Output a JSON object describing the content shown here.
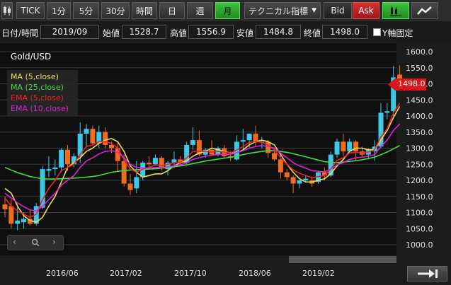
{
  "toolbar": {
    "buttons": [
      {
        "label": "TICK"
      },
      {
        "label": "1分"
      },
      {
        "label": "5分"
      },
      {
        "label": "30分"
      },
      {
        "label": "時間"
      },
      {
        "label": "日"
      },
      {
        "label": "週"
      },
      {
        "label": "月"
      }
    ],
    "active": "月",
    "indicator_dropdown": "テクニカル指標",
    "bid_label": "Bid",
    "ask_label": "Ask",
    "chart_type_icon": "candlestick-icon",
    "line_icon": "line-chart-icon"
  },
  "info": {
    "date_label": "日付/時間",
    "date_value": "2019/09",
    "open_label": "始値",
    "open_value": "1528.7",
    "high_label": "高値",
    "high_value": "1556.9",
    "low_label": "安値",
    "low_value": "1484.8",
    "close_label": "終値",
    "close_value": "1498.0",
    "yfix_label": "Y軸固定"
  },
  "chart": {
    "symbol": "Gold/USD",
    "last_price": "1498.0",
    "legend": [
      {
        "label": "MA (5,close)",
        "color": "#e8e050"
      },
      {
        "label": "MA (25,close)",
        "color": "#44dd44"
      },
      {
        "label": "EMA (5,close)",
        "color": "#ee2222"
      },
      {
        "label": "EMA (10,close)",
        "color": "#dd22dd"
      }
    ],
    "y_ticks": [
      "1600.0",
      "1550.0",
      "1500.0",
      "1450.0",
      "1400.0",
      "1350.0",
      "1300.0",
      "1250.0",
      "1200.0",
      "1150.0",
      "1100.0",
      "1050.0",
      "1000.0"
    ],
    "x_ticks": [
      "2016/06",
      "2017/02",
      "2017/10",
      "2018/06",
      "2019/02"
    ],
    "up_color": "#3ec8e8",
    "down_color": "#f26a1e"
  },
  "chart_data": {
    "type": "candlestick",
    "ylim": [
      1000,
      1600
    ],
    "candles": [
      {
        "o": 1125,
        "h": 1150,
        "l": 1085,
        "c": 1110
      },
      {
        "o": 1120,
        "h": 1140,
        "l": 1050,
        "c": 1065
      },
      {
        "o": 1065,
        "h": 1120,
        "l": 1045,
        "c": 1075
      },
      {
        "o": 1070,
        "h": 1100,
        "l": 1050,
        "c": 1080
      },
      {
        "o": 1080,
        "h": 1110,
        "l": 1060,
        "c": 1065
      },
      {
        "o": 1065,
        "h": 1130,
        "l": 1060,
        "c": 1120
      },
      {
        "o": 1115,
        "h": 1245,
        "l": 1110,
        "c": 1235
      },
      {
        "o": 1230,
        "h": 1275,
        "l": 1210,
        "c": 1235
      },
      {
        "o": 1235,
        "h": 1265,
        "l": 1215,
        "c": 1240
      },
      {
        "o": 1240,
        "h": 1300,
        "l": 1225,
        "c": 1295
      },
      {
        "o": 1295,
        "h": 1310,
        "l": 1230,
        "c": 1250
      },
      {
        "o": 1250,
        "h": 1285,
        "l": 1240,
        "c": 1275
      },
      {
        "o": 1275,
        "h": 1380,
        "l": 1255,
        "c": 1345
      },
      {
        "o": 1345,
        "h": 1375,
        "l": 1305,
        "c": 1360
      },
      {
        "o": 1360,
        "h": 1370,
        "l": 1310,
        "c": 1315
      },
      {
        "o": 1315,
        "h": 1370,
        "l": 1300,
        "c": 1350
      },
      {
        "o": 1350,
        "h": 1365,
        "l": 1300,
        "c": 1310
      },
      {
        "o": 1310,
        "h": 1320,
        "l": 1285,
        "c": 1300
      },
      {
        "o": 1300,
        "h": 1320,
        "l": 1230,
        "c": 1260
      },
      {
        "o": 1260,
        "h": 1280,
        "l": 1180,
        "c": 1190
      },
      {
        "o": 1190,
        "h": 1220,
        "l": 1155,
        "c": 1170
      },
      {
        "o": 1175,
        "h": 1260,
        "l": 1160,
        "c": 1210
      },
      {
        "o": 1210,
        "h": 1260,
        "l": 1200,
        "c": 1255
      },
      {
        "o": 1255,
        "h": 1275,
        "l": 1240,
        "c": 1250
      },
      {
        "o": 1250,
        "h": 1280,
        "l": 1245,
        "c": 1270
      },
      {
        "o": 1270,
        "h": 1275,
        "l": 1230,
        "c": 1240
      },
      {
        "o": 1235,
        "h": 1260,
        "l": 1215,
        "c": 1255
      },
      {
        "o": 1255,
        "h": 1290,
        "l": 1240,
        "c": 1265
      },
      {
        "o": 1265,
        "h": 1275,
        "l": 1245,
        "c": 1255
      },
      {
        "o": 1255,
        "h": 1320,
        "l": 1250,
        "c": 1310
      },
      {
        "o": 1310,
        "h": 1365,
        "l": 1295,
        "c": 1325
      },
      {
        "o": 1325,
        "h": 1355,
        "l": 1275,
        "c": 1280
      },
      {
        "o": 1280,
        "h": 1300,
        "l": 1270,
        "c": 1295
      },
      {
        "o": 1295,
        "h": 1325,
        "l": 1275,
        "c": 1280
      },
      {
        "o": 1280,
        "h": 1305,
        "l": 1275,
        "c": 1300
      },
      {
        "o": 1300,
        "h": 1310,
        "l": 1270,
        "c": 1275
      },
      {
        "o": 1275,
        "h": 1290,
        "l": 1260,
        "c": 1270
      },
      {
        "o": 1265,
        "h": 1340,
        "l": 1262,
        "c": 1320
      },
      {
        "o": 1320,
        "h": 1360,
        "l": 1295,
        "c": 1325
      },
      {
        "o": 1325,
        "h": 1345,
        "l": 1300,
        "c": 1345
      },
      {
        "o": 1345,
        "h": 1370,
        "l": 1305,
        "c": 1320
      },
      {
        "o": 1320,
        "h": 1335,
        "l": 1300,
        "c": 1320
      },
      {
        "o": 1320,
        "h": 1325,
        "l": 1270,
        "c": 1285
      },
      {
        "o": 1285,
        "h": 1290,
        "l": 1260,
        "c": 1265
      },
      {
        "o": 1265,
        "h": 1280,
        "l": 1205,
        "c": 1225
      },
      {
        "o": 1225,
        "h": 1235,
        "l": 1200,
        "c": 1210
      },
      {
        "o": 1210,
        "h": 1215,
        "l": 1160,
        "c": 1190
      },
      {
        "o": 1190,
        "h": 1200,
        "l": 1175,
        "c": 1200
      },
      {
        "o": 1200,
        "h": 1215,
        "l": 1195,
        "c": 1205
      },
      {
        "o": 1200,
        "h": 1210,
        "l": 1180,
        "c": 1190
      },
      {
        "o": 1195,
        "h": 1230,
        "l": 1190,
        "c": 1225
      },
      {
        "o": 1225,
        "h": 1240,
        "l": 1200,
        "c": 1215
      },
      {
        "o": 1215,
        "h": 1290,
        "l": 1210,
        "c": 1280
      },
      {
        "o": 1280,
        "h": 1330,
        "l": 1270,
        "c": 1320
      },
      {
        "o": 1320,
        "h": 1345,
        "l": 1275,
        "c": 1290
      },
      {
        "o": 1290,
        "h": 1330,
        "l": 1285,
        "c": 1320
      },
      {
        "o": 1320,
        "h": 1325,
        "l": 1260,
        "c": 1290
      },
      {
        "o": 1290,
        "h": 1305,
        "l": 1270,
        "c": 1280
      },
      {
        "o": 1280,
        "h": 1300,
        "l": 1265,
        "c": 1295
      },
      {
        "o": 1290,
        "h": 1325,
        "l": 1260,
        "c": 1305
      },
      {
        "o": 1305,
        "h": 1440,
        "l": 1300,
        "c": 1410
      },
      {
        "o": 1410,
        "h": 1440,
        "l": 1390,
        "c": 1415
      },
      {
        "o": 1415,
        "h": 1555,
        "l": 1400,
        "c": 1520
      },
      {
        "o": 1528.7,
        "h": 1556.9,
        "l": 1484.8,
        "c": 1498.0
      }
    ],
    "series": [
      {
        "name": "MA (5,close)",
        "values": [
          1175,
          1160,
          1120,
          1090,
          1075,
          1070,
          1085,
          1120,
          1150,
          1195,
          1240,
          1255,
          1270,
          1290,
          1300,
          1315,
          1325,
          1330,
          1320,
          1290,
          1245,
          1225,
          1210,
          1215,
          1220,
          1220,
          1230,
          1245,
          1255,
          1260,
          1275,
          1285,
          1290,
          1300,
          1295,
          1290,
          1285,
          1285,
          1295,
          1310,
          1320,
          1325,
          1320,
          1310,
          1280,
          1250,
          1225,
          1205,
          1195,
          1195,
          1200,
          1205,
          1220,
          1245,
          1265,
          1290,
          1300,
          1300,
          1295,
          1295,
          1325,
          1355,
          1395,
          1430
        ]
      },
      {
        "name": "MA (25,close)",
        "values": [
          1240,
          1232,
          1224,
          1218,
          1212,
          1208,
          1205,
          1204,
          1204,
          1205,
          1206,
          1207,
          1208,
          1210,
          1212,
          1215,
          1220,
          1225,
          1228,
          1230,
          1232,
          1233,
          1234,
          1235,
          1236,
          1238,
          1240,
          1242,
          1245,
          1248,
          1252,
          1256,
          1260,
          1263,
          1266,
          1269,
          1272,
          1276,
          1280,
          1284,
          1287,
          1290,
          1292,
          1292,
          1290,
          1287,
          1283,
          1278,
          1273,
          1268,
          1263,
          1258,
          1256,
          1255,
          1257,
          1259,
          1261,
          1264,
          1268,
          1272,
          1280,
          1288,
          1298,
          1308
        ]
      },
      {
        "name": "EMA (5,close)",
        "values": [
          1145,
          1120,
          1105,
          1095,
          1085,
          1095,
          1140,
          1175,
          1200,
          1230,
          1240,
          1250,
          1280,
          1305,
          1310,
          1320,
          1320,
          1315,
          1300,
          1265,
          1235,
          1225,
          1235,
          1240,
          1248,
          1245,
          1250,
          1255,
          1255,
          1270,
          1290,
          1290,
          1290,
          1288,
          1290,
          1288,
          1285,
          1295,
          1305,
          1318,
          1320,
          1320,
          1308,
          1295,
          1270,
          1250,
          1232,
          1222,
          1215,
          1208,
          1212,
          1215,
          1235,
          1262,
          1270,
          1285,
          1287,
          1285,
          1288,
          1295,
          1335,
          1360,
          1410,
          1440
        ]
      },
      {
        "name": "EMA (10,close)",
        "values": [
          1160,
          1145,
          1130,
          1118,
          1108,
          1105,
          1120,
          1140,
          1160,
          1185,
          1200,
          1215,
          1240,
          1260,
          1270,
          1282,
          1290,
          1292,
          1288,
          1270,
          1250,
          1240,
          1238,
          1238,
          1240,
          1240,
          1242,
          1245,
          1248,
          1255,
          1265,
          1270,
          1275,
          1278,
          1280,
          1281,
          1281,
          1286,
          1292,
          1300,
          1305,
          1308,
          1305,
          1300,
          1285,
          1270,
          1255,
          1245,
          1238,
          1230,
          1228,
          1226,
          1235,
          1248,
          1255,
          1265,
          1270,
          1272,
          1275,
          1280,
          1305,
          1325,
          1355,
          1375
        ]
      }
    ]
  }
}
